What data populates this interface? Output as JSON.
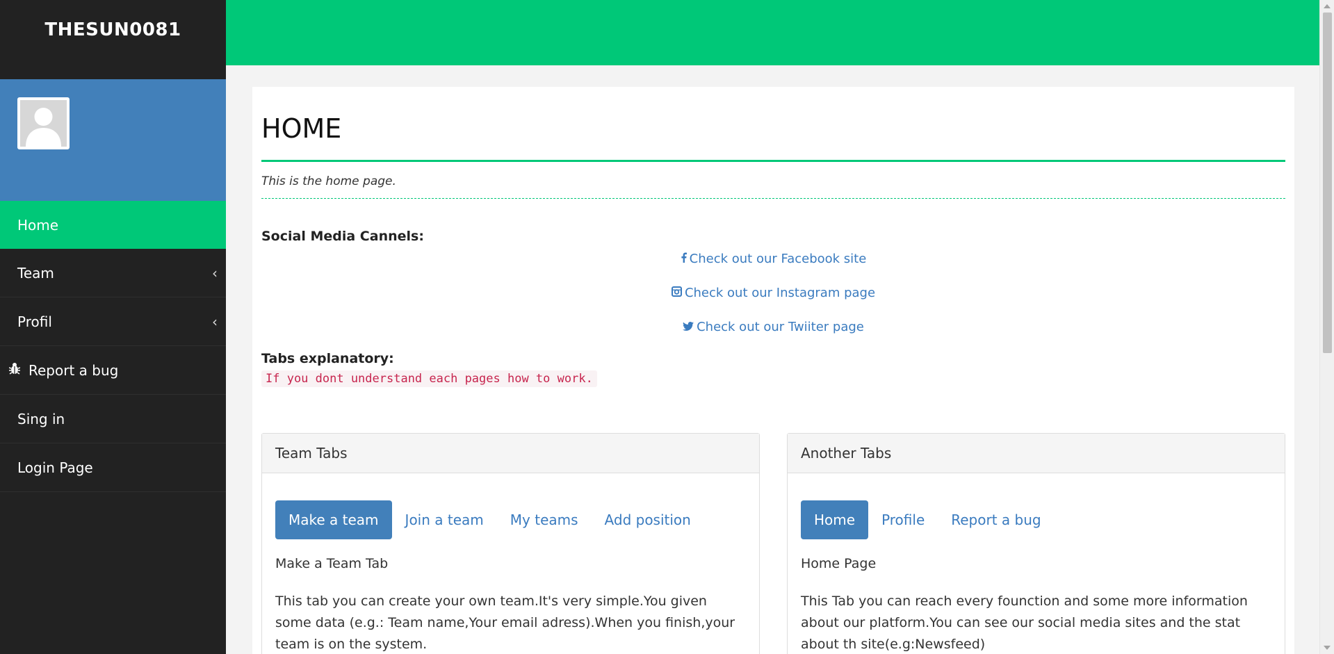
{
  "brand": "THESUN0081",
  "colors": {
    "accent": "#00c878",
    "primary": "#4280ba",
    "sidebar": "#222222",
    "code_text": "#c7254e"
  },
  "sidebar": {
    "items": [
      {
        "label": "Home",
        "active": true,
        "icon": ""
      },
      {
        "label": "Team",
        "icon": "chevron-left-icon"
      },
      {
        "label": "Profil",
        "icon": "chevron-left-icon"
      },
      {
        "label": "Report a bug",
        "icon": "bug-icon"
      },
      {
        "label": "Sing in",
        "icon": ""
      },
      {
        "label": "Login Page",
        "icon": ""
      }
    ]
  },
  "page": {
    "title": "HOME",
    "subtitle": "This is the home page.",
    "social_heading": "Social Media Cannels:",
    "social_links": [
      {
        "label": "Check out our Facebook site",
        "icon": "facebook-icon"
      },
      {
        "label": "Check out our Instagram page",
        "icon": "instagram-icon"
      },
      {
        "label": "Check out our Twiiter page",
        "icon": "twitter-icon"
      }
    ],
    "tabs_heading": "Tabs explanatory:",
    "tabs_note": "If you dont understand each pages how to work."
  },
  "team_panel": {
    "heading": "Team Tabs",
    "tabs": [
      "Make a team",
      "Join a team",
      "My teams",
      "Add position"
    ],
    "active_tab": "Make a team",
    "tab_title": "Make a Team Tab",
    "tab_text": "This tab you can create your own team.It's very simple.You given some data (e.g.: Team name,Your email adress).When you finish,your team is on the system."
  },
  "another_panel": {
    "heading": "Another Tabs",
    "tabs": [
      "Home",
      "Profile",
      "Report a bug"
    ],
    "active_tab": "Home",
    "tab_title": "Home Page",
    "tab_text": "This Tab you can reach every founction and some more information about our platform.You can see our social media sites and the stat about th site(e.g:Newsfeed)"
  }
}
